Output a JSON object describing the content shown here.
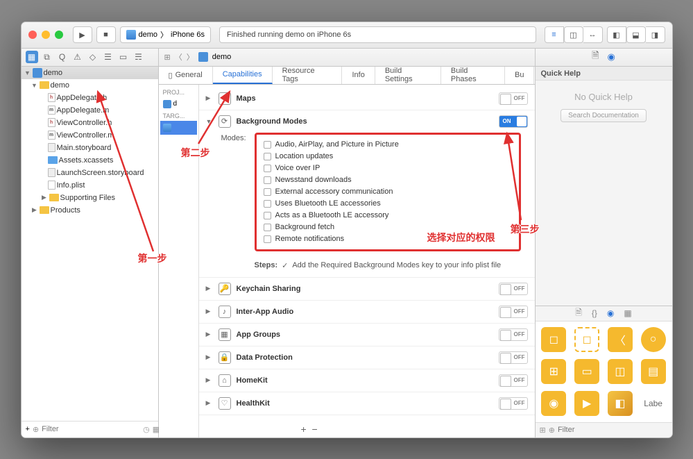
{
  "titlebar": {
    "scheme_app": "demo",
    "scheme_device": "iPhone 6s",
    "status": "Finished running demo on iPhone 6s"
  },
  "toolbar2": {
    "breadcrumb": "demo"
  },
  "navigator": {
    "project": "demo",
    "group": "demo",
    "files": [
      "AppDelegate.h",
      "AppDelegate.m",
      "ViewController.h",
      "ViewController.m",
      "Main.storyboard",
      "Assets.xcassets",
      "LaunchScreen.storyboard",
      "Info.plist"
    ],
    "supporting": "Supporting Files",
    "products": "Products",
    "filter_placeholder": "Filter"
  },
  "editor_tabs": [
    "General",
    "Capabilities",
    "Resource Tags",
    "Info",
    "Build Settings",
    "Build Phases",
    "Bu"
  ],
  "targets": {
    "proj_label": "PROJ...",
    "proj_name": "d",
    "targ_label": "TARG..."
  },
  "capabilities": [
    {
      "name": "Maps",
      "on": false,
      "expanded": false
    },
    {
      "name": "Background Modes",
      "on": true,
      "expanded": true
    },
    {
      "name": "Keychain Sharing",
      "on": false,
      "expanded": false
    },
    {
      "name": "Inter-App Audio",
      "on": false,
      "expanded": false
    },
    {
      "name": "App Groups",
      "on": false,
      "expanded": false
    },
    {
      "name": "Data Protection",
      "on": false,
      "expanded": false
    },
    {
      "name": "HomeKit",
      "on": false,
      "expanded": false
    },
    {
      "name": "HealthKit",
      "on": false,
      "expanded": false
    }
  ],
  "modes": {
    "label": "Modes:",
    "items": [
      "Audio, AirPlay, and Picture in Picture",
      "Location updates",
      "Voice over IP",
      "Newsstand downloads",
      "External accessory communication",
      "Uses Bluetooth LE accessories",
      "Acts as a Bluetooth LE accessory",
      "Background fetch",
      "Remote notifications"
    ]
  },
  "steps": {
    "label": "Steps:",
    "text": "Add the Required Background Modes key to your info plist file"
  },
  "switch": {
    "on": "ON",
    "off": "OFF"
  },
  "inspector": {
    "title": "Quick Help",
    "empty": "No Quick Help",
    "button": "Search Documentation"
  },
  "library": {
    "filter_placeholder": "Filter",
    "label_text": "Labe"
  },
  "annotations": {
    "step1": "第一步",
    "step2": "第二步",
    "step3": "第三步",
    "select": "选择对应的权限"
  }
}
